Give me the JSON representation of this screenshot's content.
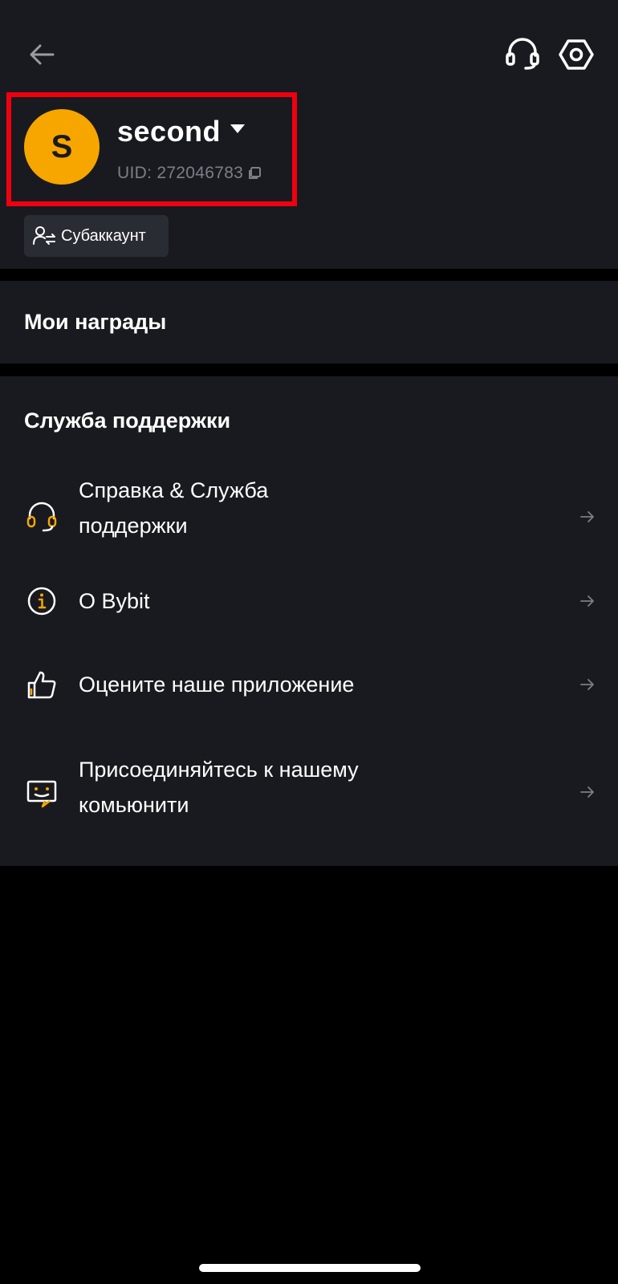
{
  "header": {
    "back_icon": "arrow-left-icon",
    "support_icon": "headset-icon",
    "settings_icon": "hex-gear-icon"
  },
  "profile": {
    "avatar_letter": "S",
    "avatar_color": "#f7a600",
    "username": "second",
    "uid": "UID: 272046783",
    "highlight_color": "#f0000f",
    "subaccount_label": "Субаккаунт"
  },
  "rewards": {
    "title": "Мои награды"
  },
  "support": {
    "title": "Служба поддержки",
    "items": [
      {
        "label": "Справка & Служба поддержки",
        "icon": "headset-icon"
      },
      {
        "label": "О Bybit",
        "icon": "info-icon"
      },
      {
        "label": "Оцените наше приложение",
        "icon": "thumbs-up-icon"
      },
      {
        "label": "Присоединяйтесь к нашему комьюнити",
        "icon": "chat-smile-icon"
      }
    ]
  },
  "colors": {
    "accent": "#f7a600",
    "panel": "#191a1f",
    "background": "#000000"
  }
}
